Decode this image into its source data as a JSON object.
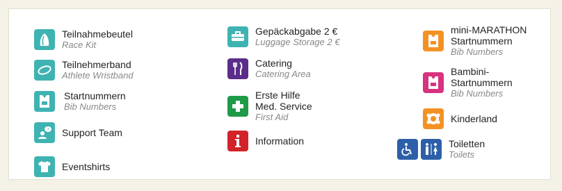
{
  "legend": {
    "col1": [
      {
        "de": "Teilnahmebeutel",
        "en": "Race Kit",
        "icon": "race-kit-bag-icon"
      },
      {
        "de": "Teilnehmerband",
        "en": "Athlete Wristband",
        "icon": "wristband-icon"
      },
      {
        "de": "Startnummern",
        "en": "Bib Numbers",
        "icon": "bib-number-icon"
      },
      {
        "de": "Support Team",
        "en": "",
        "icon": "support-team-icon"
      },
      {
        "de": "Eventshirts",
        "en": "",
        "icon": "shirt-icon"
      }
    ],
    "col2": [
      {
        "de": "Gepäckabgabe 2 €",
        "en": "Luggage Storage 2 €",
        "icon": "luggage-icon"
      },
      {
        "de": "Catering",
        "en": "Catering Area",
        "icon": "fork-knife-icon"
      },
      {
        "de": "Erste Hilfe",
        "de2": "Med. Service",
        "en": "First Aid",
        "icon": "first-aid-cross-icon"
      },
      {
        "de": "Information",
        "en": "",
        "icon": "info-icon"
      }
    ],
    "col3": [
      {
        "de": "mini-MARATHON",
        "de2": "Startnummern",
        "en": "Bib Numbers",
        "icon": "mini-marathon-bib-icon"
      },
      {
        "de": "Bambini-",
        "de2": "Startnummern",
        "en": "Bib Numbers",
        "icon": "bambini-bib-icon"
      },
      {
        "de": "Kinderland",
        "en": "",
        "icon": "kids-area-icon"
      },
      {
        "de": "Toiletten",
        "en": "Toilets",
        "icon": "toilet-icon"
      }
    ]
  },
  "colors": {
    "teal": "#3fb3b2",
    "purple": "#5b2d8a",
    "green": "#1f9a48",
    "red": "#d2232a",
    "orange": "#f39224",
    "pink": "#d8327f",
    "blue": "#2d5fa8"
  }
}
